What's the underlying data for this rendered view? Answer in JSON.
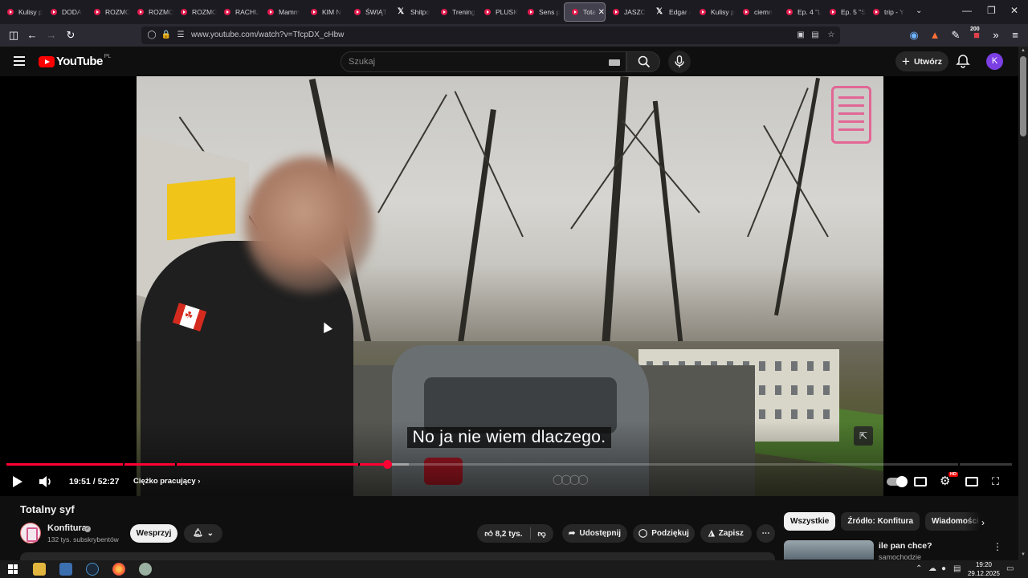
{
  "browser": {
    "tabs": [
      {
        "label": "Kulisy p",
        "icon": "youtube-favicon"
      },
      {
        "label": "DODA",
        "icon": "youtube-favicon"
      },
      {
        "label": "ROZMO",
        "icon": "youtube-favicon"
      },
      {
        "label": "ROZMO",
        "icon": "youtube-favicon"
      },
      {
        "label": "ROZMO",
        "icon": "youtube-favicon"
      },
      {
        "label": "RACHU",
        "icon": "youtube-favicon"
      },
      {
        "label": "Mamm",
        "icon": "youtube-favicon"
      },
      {
        "label": "KIM N",
        "icon": "youtube-favicon"
      },
      {
        "label": "ŚWIĄT",
        "icon": "youtube-favicon"
      },
      {
        "label": "Shitpo",
        "icon": "x-favicon"
      },
      {
        "label": "Trening",
        "icon": "youtube-favicon"
      },
      {
        "label": "PLUSK",
        "icon": "youtube-favicon"
      },
      {
        "label": "Sens p",
        "icon": "youtube-favicon"
      },
      {
        "label": "Tota",
        "icon": "youtube-favicon",
        "active": true
      },
      {
        "label": "JASZC",
        "icon": "youtube-favicon"
      },
      {
        "label": "Edgar /",
        "icon": "x-favicon"
      },
      {
        "label": "Kulisy p",
        "icon": "youtube-favicon"
      },
      {
        "label": "ciemn",
        "icon": "youtube-favicon"
      },
      {
        "label": "Ep. 4 \"L",
        "icon": "youtube-favicon"
      },
      {
        "label": "Ep. 5 \"S",
        "icon": "youtube-favicon"
      },
      {
        "label": "trip - Y",
        "icon": "youtube-favicon"
      }
    ],
    "url": "www.youtube.com/watch?v=TfcpDX_cHbw",
    "extension_badge": "200"
  },
  "youtube": {
    "logo_text": "YouTube",
    "country_code": "PL",
    "search_placeholder": "Szukaj",
    "create_label": "Utwórz",
    "avatar_letter": "K"
  },
  "player": {
    "subtitle": "No ja nie wiem dlaczego.",
    "current_time": "19:51",
    "duration": "52:27",
    "time_display": "19:51 / 52:27",
    "chapter": "Ciężko pracujący",
    "progress_fraction": 0.3785,
    "buffer_fraction": 0.4,
    "hd_badge": "HD",
    "accent_color": "#ff0033"
  },
  "video": {
    "title": "Totalny syf",
    "channel_name": "Konfitura",
    "subscribers": "132 tys. subskrybentów",
    "join_label": "Wesprzyj",
    "likes": "8,2 tys.",
    "share_label": "Udostępnij",
    "thanks_label": "Podziękuj",
    "save_label": "Zapisz"
  },
  "sidebar": {
    "chips": [
      {
        "label": "Wszystkie",
        "selected": true
      },
      {
        "label": "Źródło: Konfitura",
        "selected": false
      },
      {
        "label": "Wiadomości ze ś",
        "selected": false
      }
    ],
    "recommendation": {
      "title": "ile pan chce?",
      "channel": "samochodzie"
    }
  },
  "taskbar": {
    "time": "19:20",
    "date": "29.12.2025"
  }
}
